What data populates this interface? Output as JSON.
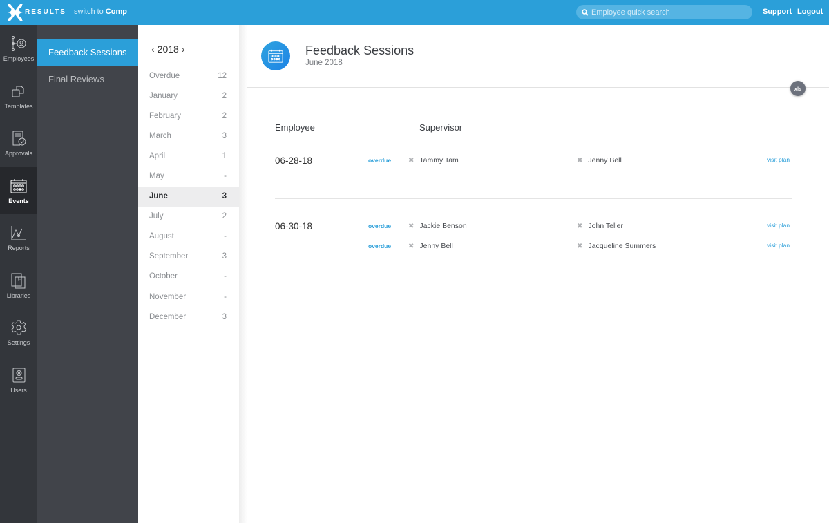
{
  "topbar": {
    "brand": "RESULTS",
    "switch_prefix": "switch to",
    "switch_target": "Comp",
    "search_placeholder": "Employee quick search",
    "support": "Support",
    "logout": "Logout"
  },
  "rail": {
    "items": [
      {
        "label": "Employees",
        "icon": "org-chart-icon"
      },
      {
        "label": "Templates",
        "icon": "templates-icon"
      },
      {
        "label": "Approvals",
        "icon": "approvals-icon"
      },
      {
        "label": "Events",
        "icon": "calendar-icon",
        "active": true
      },
      {
        "label": "Reports",
        "icon": "line-chart-icon"
      },
      {
        "label": "Libraries",
        "icon": "library-icon"
      },
      {
        "label": "Settings",
        "icon": "gear-icon"
      },
      {
        "label": "Users",
        "icon": "user-badge-icon"
      }
    ]
  },
  "subnav": {
    "items": [
      {
        "label": "Feedback Sessions",
        "active": true
      },
      {
        "label": "Final Reviews"
      }
    ]
  },
  "months": {
    "year": "2018",
    "items": [
      {
        "label": "Overdue",
        "count": "12"
      },
      {
        "label": "January",
        "count": "2"
      },
      {
        "label": "February",
        "count": "2"
      },
      {
        "label": "March",
        "count": "3"
      },
      {
        "label": "April",
        "count": "1"
      },
      {
        "label": "May",
        "count": "-"
      },
      {
        "label": "June",
        "count": "3",
        "active": true
      },
      {
        "label": "July",
        "count": "2"
      },
      {
        "label": "August",
        "count": "-"
      },
      {
        "label": "September",
        "count": "3"
      },
      {
        "label": "October",
        "count": "-"
      },
      {
        "label": "November",
        "count": "-"
      },
      {
        "label": "December",
        "count": "3"
      }
    ]
  },
  "main": {
    "title": "Feedback Sessions",
    "subtitle": "June 2018",
    "export_label": "xls",
    "columns": {
      "employee": "Employee",
      "supervisor": "Supervisor"
    },
    "groups": [
      {
        "date": "06-28-18",
        "sessions": [
          {
            "status": "overdue",
            "employee": "Tammy Tam",
            "supervisor": "Jenny Bell",
            "action": "visit plan"
          }
        ]
      },
      {
        "date": "06-30-18",
        "sessions": [
          {
            "status": "overdue",
            "employee": "Jackie Benson",
            "supervisor": "John Teller",
            "action": "visit plan"
          },
          {
            "status": "overdue",
            "employee": "Jenny Bell",
            "supervisor": "Jacqueline Summers",
            "action": "visit plan"
          }
        ]
      }
    ]
  },
  "colors": {
    "accent": "#2b9fd9",
    "rail": "#33363b",
    "subnav": "#41444a"
  }
}
